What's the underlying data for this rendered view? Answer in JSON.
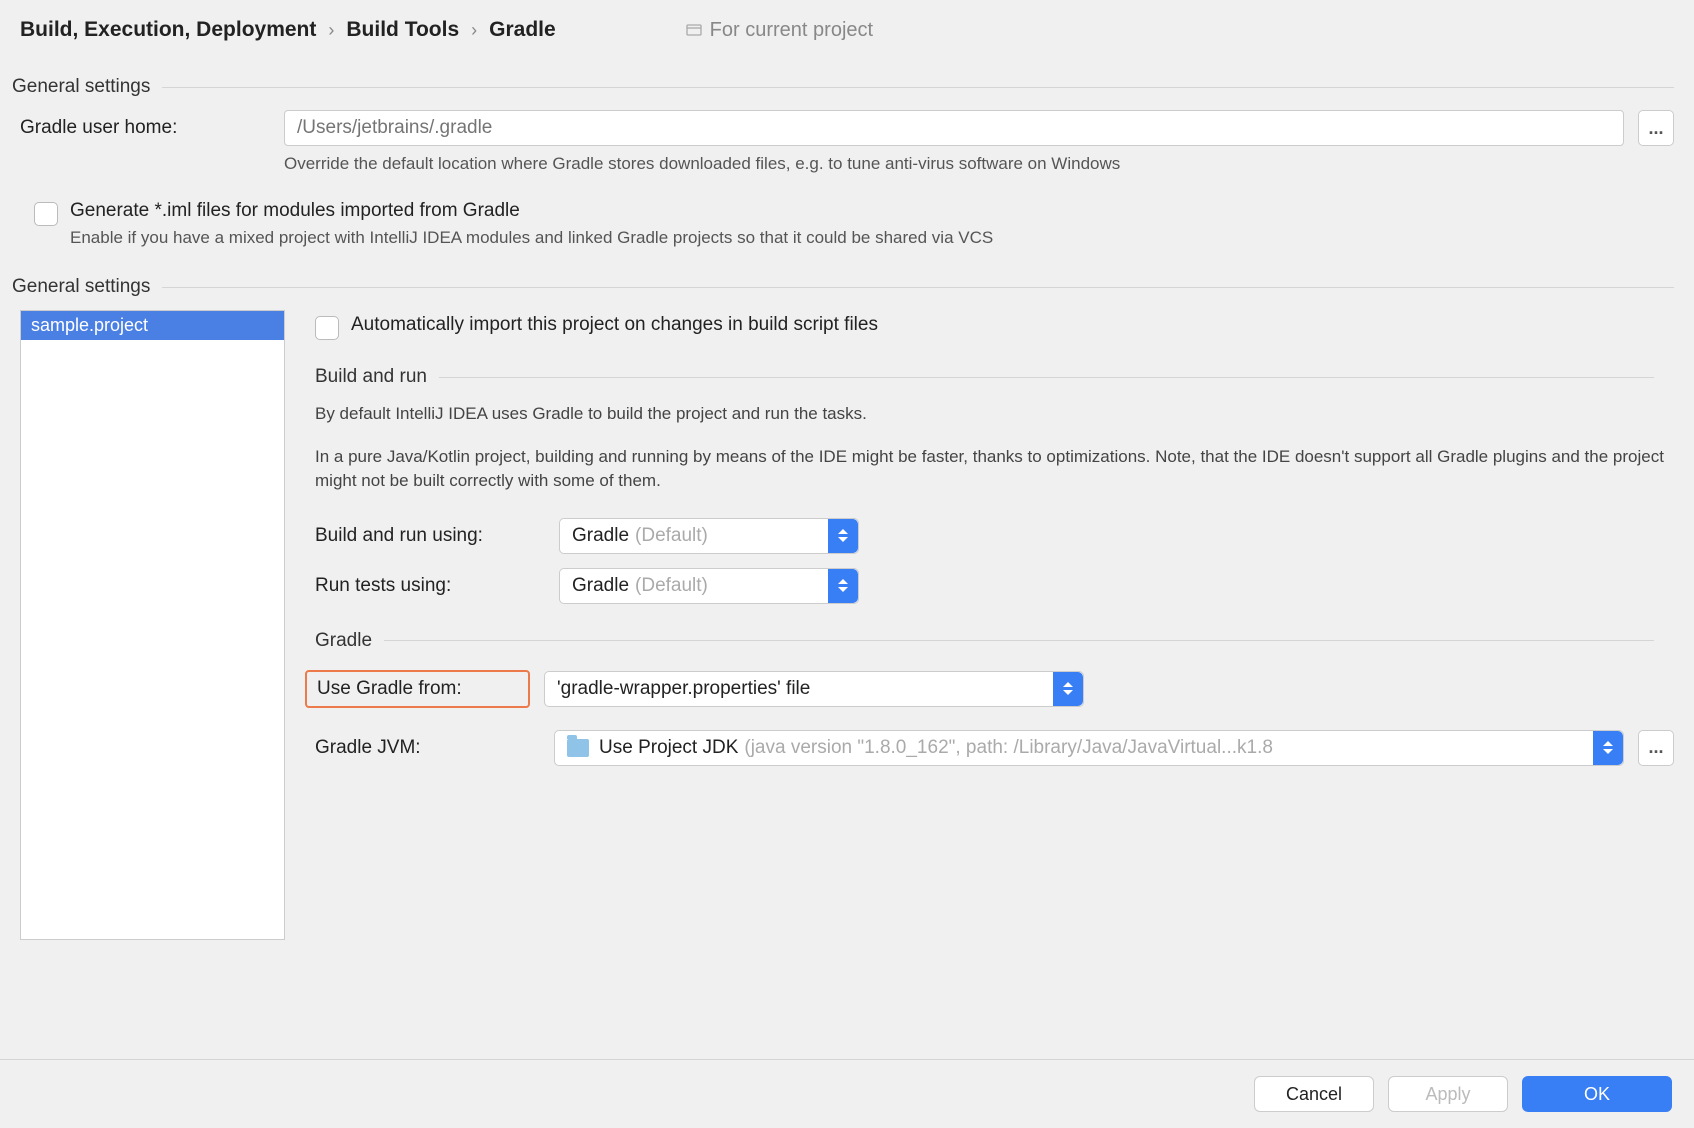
{
  "breadcrumb": {
    "item1": "Build, Execution, Deployment",
    "item2": "Build Tools",
    "item3": "Gradle",
    "current_project": "For current project"
  },
  "sections": {
    "general1": "General settings",
    "general2": "General settings",
    "build_and_run": "Build and run",
    "gradle": "Gradle"
  },
  "general": {
    "user_home_label": "Gradle user home:",
    "user_home_placeholder": "/Users/jetbrains/.gradle",
    "user_home_hint": "Override the default location where Gradle stores downloaded files, e.g. to tune anti-virus software on Windows",
    "generate_iml_label": "Generate *.iml files for modules imported from Gradle",
    "generate_iml_hint": "Enable if you have a mixed project with IntelliJ IDEA modules and linked Gradle projects so that it could be shared via VCS",
    "dots": "..."
  },
  "projects": {
    "items": [
      "sample.project"
    ]
  },
  "right": {
    "auto_import_label": "Automatically import this project on changes in build script files",
    "build_run_desc1": "By default IntelliJ IDEA uses Gradle to build the project and run the tasks.",
    "build_run_desc2": "In a pure Java/Kotlin project, building and running by means of the IDE might be faster, thanks to optimizations. Note, that the IDE doesn't support all Gradle plugins and the project might not be built correctly with some of them.",
    "build_using_label": "Build and run using:",
    "run_tests_label": "Run tests using:",
    "combo_gradle": "Gradle",
    "combo_default": "(Default)",
    "use_gradle_from_label": "Use Gradle from:",
    "use_gradle_from_value": "'gradle-wrapper.properties' file",
    "gradle_jvm_label": "Gradle JVM:",
    "gradle_jvm_value": "Use Project JDK",
    "gradle_jvm_detail": "(java version \"1.8.0_162\", path: /Library/Java/JavaVirtual...k1.8",
    "dots": "..."
  },
  "buttons": {
    "cancel": "Cancel",
    "apply": "Apply",
    "ok": "OK"
  }
}
